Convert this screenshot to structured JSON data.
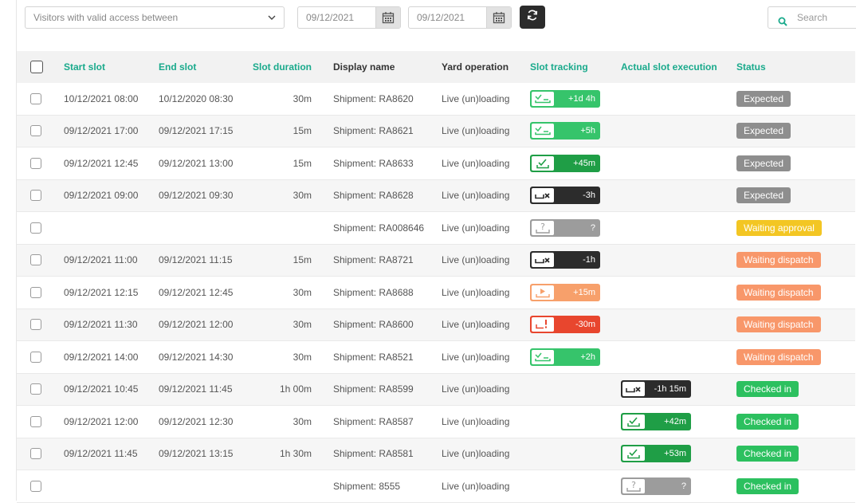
{
  "toolbar": {
    "filter_select": "Visitors with valid access between",
    "date_from": "09/12/2021",
    "date_to": "09/12/2021",
    "search_placeholder": "Search"
  },
  "columns": {
    "start": "Start slot",
    "end": "End slot",
    "duration": "Slot duration",
    "name": "Display name",
    "yard": "Yard operation",
    "tracking": "Slot tracking",
    "execution": "Actual slot execution",
    "status": "Status"
  },
  "colors": {
    "accent_teal": "#1aaa8c",
    "green": "#36c46b",
    "dark_green": "#1f9e46",
    "dark": "#2c2c2c",
    "grey": "#9c9c9c",
    "orange": "#f7a06b",
    "red": "#e8462e",
    "yellow": "#f3c623"
  },
  "rows": [
    {
      "start": "10/12/2021 08:00",
      "end": "10/12/2020 08:30",
      "duration": "30m",
      "name": "Shipment: RA8620",
      "yard": "Live (un)loading",
      "tracking": {
        "style": "green",
        "icon": "truck-check-icon",
        "text": "+1d 4h"
      },
      "execution": null,
      "status": {
        "style": "expected",
        "text": "Expected"
      }
    },
    {
      "start": "09/12/2021 17:00",
      "end": "09/12/2021 17:15",
      "duration": "15m",
      "name": "Shipment: RA8621",
      "yard": "Live (un)loading",
      "tracking": {
        "style": "green",
        "icon": "truck-check-icon",
        "text": "+5h"
      },
      "execution": null,
      "status": {
        "style": "expected",
        "text": "Expected"
      }
    },
    {
      "start": "09/12/2021 12:45",
      "end": "09/12/2021 13:00",
      "duration": "15m",
      "name": "Shipment: RA8633",
      "yard": "Live (un)loading",
      "tracking": {
        "style": "darkgreen",
        "icon": "check-box-icon",
        "text": "+45m"
      },
      "execution": null,
      "status": {
        "style": "expected",
        "text": "Expected"
      }
    },
    {
      "start": "09/12/2021 09:00",
      "end": "09/12/2021 09:30",
      "duration": "30m",
      "name": "Shipment: RA8628",
      "yard": "Live (un)loading",
      "tracking": {
        "style": "dark",
        "icon": "truck-cross-icon",
        "text": "-3h"
      },
      "execution": null,
      "status": {
        "style": "expected",
        "text": "Expected"
      }
    },
    {
      "start": "",
      "end": "",
      "duration": "",
      "name": "Shipment: RA008646",
      "yard": "Live (un)loading",
      "tracking": {
        "style": "grey",
        "icon": "question-icon",
        "text": "?"
      },
      "execution": null,
      "status": {
        "style": "approval",
        "text": "Waiting approval"
      }
    },
    {
      "start": "09/12/2021 11:00",
      "end": "09/12/2021 11:15",
      "duration": "15m",
      "name": "Shipment: RA8721",
      "yard": "Live (un)loading",
      "tracking": {
        "style": "dark",
        "icon": "truck-cross-icon",
        "text": "-1h"
      },
      "execution": null,
      "status": {
        "style": "dispatch",
        "text": "Waiting dispatch"
      }
    },
    {
      "start": "09/12/2021 12:15",
      "end": "09/12/2021 12:45",
      "duration": "30m",
      "name": "Shipment: RA8688",
      "yard": "Live (un)loading",
      "tracking": {
        "style": "orange",
        "icon": "play-icon",
        "text": "+15m"
      },
      "execution": null,
      "status": {
        "style": "dispatch",
        "text": "Waiting dispatch"
      }
    },
    {
      "start": "09/12/2021 11:30",
      "end": "09/12/2021 12:00",
      "duration": "30m",
      "name": "Shipment: RA8600",
      "yard": "Live (un)loading",
      "tracking": {
        "style": "red",
        "icon": "alert-icon",
        "text": "-30m"
      },
      "execution": null,
      "status": {
        "style": "dispatch",
        "text": "Waiting dispatch"
      }
    },
    {
      "start": "09/12/2021 14:00",
      "end": "09/12/2021 14:30",
      "duration": "30m",
      "name": "Shipment: RA8521",
      "yard": "Live (un)loading",
      "tracking": {
        "style": "green",
        "icon": "truck-check-icon",
        "text": "+2h"
      },
      "execution": null,
      "status": {
        "style": "dispatch",
        "text": "Waiting dispatch"
      }
    },
    {
      "start": "09/12/2021 10:45",
      "end": "09/12/2021 11:45",
      "duration": "1h 00m",
      "name": "Shipment: RA8599",
      "yard": "Live (un)loading",
      "tracking": null,
      "execution": {
        "style": "dark",
        "icon": "truck-cross-icon",
        "text": "-1h 15m"
      },
      "status": {
        "style": "checked",
        "text": "Checked in"
      }
    },
    {
      "start": "09/12/2021 12:00",
      "end": "09/12/2021 12:30",
      "duration": "30m",
      "name": "Shipment: RA8587",
      "yard": "Live (un)loading",
      "tracking": null,
      "execution": {
        "style": "darkgreen",
        "icon": "check-box-icon",
        "text": "+42m"
      },
      "status": {
        "style": "checked",
        "text": "Checked in"
      }
    },
    {
      "start": "09/12/2021 11:45",
      "end": "09/12/2021 13:15",
      "duration": "1h 30m",
      "name": "Shipment: RA8581",
      "yard": "Live (un)loading",
      "tracking": null,
      "execution": {
        "style": "darkgreen",
        "icon": "check-box-icon",
        "text": "+53m"
      },
      "status": {
        "style": "checked",
        "text": "Checked in"
      }
    },
    {
      "start": "",
      "end": "",
      "duration": "",
      "name": "Shipment: 8555",
      "yard": "Live (un)loading",
      "tracking": null,
      "execution": {
        "style": "grey",
        "icon": "question-icon",
        "text": "?"
      },
      "status": {
        "style": "checked",
        "text": "Checked in"
      }
    }
  ]
}
